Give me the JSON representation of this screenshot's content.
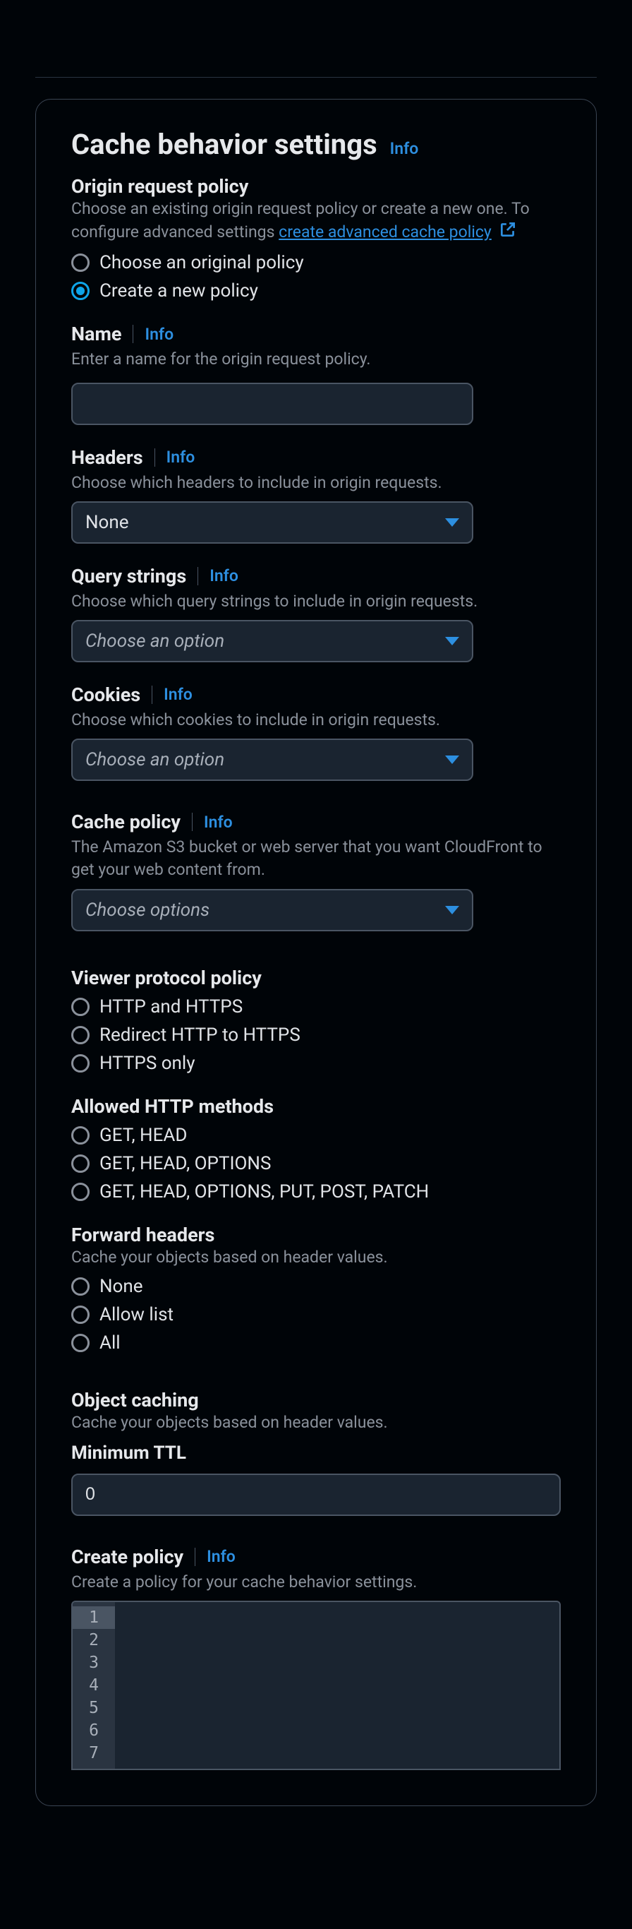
{
  "panel": {
    "title": "Cache behavior settings",
    "info": "Info"
  },
  "origin_request_policy": {
    "label": "Origin request policy",
    "helper": "Choose an existing origin request policy or create a new one. To configure advanced settings ",
    "link_text": "create advanced cache policy",
    "radio": {
      "choose": "Choose an original policy",
      "create": "Create a new policy"
    }
  },
  "name": {
    "label": "Name",
    "info": "Info",
    "helper": "Enter a name for the origin request policy.",
    "value": ""
  },
  "headers": {
    "label": "Headers",
    "info": "Info",
    "helper": "Choose which headers to include in origin requests.",
    "value": "None"
  },
  "query_strings": {
    "label": "Query strings",
    "info": "Info",
    "helper": "Choose which query strings to include in origin requests.",
    "placeholder": "Choose an option"
  },
  "cookies": {
    "label": "Cookies",
    "info": "Info",
    "helper": "Choose which cookies to include in origin requests.",
    "placeholder": "Choose an option"
  },
  "cache_policy": {
    "label": "Cache policy",
    "info": "Info",
    "helper": "The Amazon S3 bucket or web server that you want CloudFront to get your web content from.",
    "placeholder": "Choose options"
  },
  "viewer_protocol": {
    "label": "Viewer protocol policy",
    "options": [
      "HTTP and HTTPS",
      "Redirect HTTP to HTTPS",
      "HTTPS only"
    ]
  },
  "allowed_methods": {
    "label": "Allowed HTTP methods",
    "options": [
      "GET, HEAD",
      "GET, HEAD, OPTIONS",
      "GET, HEAD, OPTIONS, PUT, POST, PATCH"
    ]
  },
  "forward_headers": {
    "label": "Forward headers",
    "helper": "Cache your objects based on header values.",
    "options": [
      "None",
      "Allow list",
      "All"
    ]
  },
  "object_caching": {
    "label": "Object caching",
    "helper": "Cache your objects based on header values.",
    "min_ttl_label": "Minimum TTL",
    "min_ttl_value": "0"
  },
  "create_policy": {
    "label": "Create policy",
    "info": "Info",
    "helper": "Create a policy for your cache behavior settings.",
    "lines": [
      "1",
      "2",
      "3",
      "4",
      "5",
      "6",
      "7"
    ]
  }
}
